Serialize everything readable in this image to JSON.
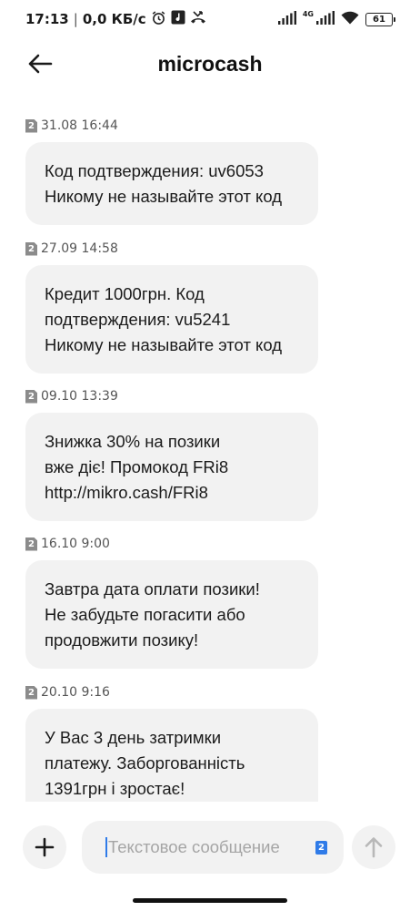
{
  "status_bar": {
    "time": "17:13",
    "separator": "|",
    "speed": "0,0 КБ/с",
    "network": "4G",
    "battery": "61"
  },
  "header": {
    "title": "microcash"
  },
  "messages": [
    {
      "sim": "2",
      "date": "31.08 16:44",
      "text": "Код подтверждения: uv6053\nНикому не называйте этот код"
    },
    {
      "sim": "2",
      "date": "27.09 14:58",
      "text": "Кредит 1000грн. Код\nподтверждения: vu5241\nНикому не называйте этот код"
    },
    {
      "sim": "2",
      "date": "09.10 13:39",
      "text": "Знижка 30% на позики\nвже діє! Промокод FRi8\nhttp://mikro.cash/FRi8"
    },
    {
      "sim": "2",
      "date": "16.10 9:00",
      "text": "Завтра дата оплати позики!\nНе забудьте погасити або\nпродовжити позику!"
    },
    {
      "sim": "2",
      "date": "20.10 9:16",
      "text": "У Вас 3 день затримки\nплатежу. Заборгованність\n1391грн і зростає!"
    }
  ],
  "composer": {
    "placeholder": "Текстовое сообщение",
    "sim": "2"
  },
  "colors": {
    "bubble": "#f2f2f2",
    "accent": "#2f7be8",
    "sim_badge": "#8b8b8b"
  }
}
